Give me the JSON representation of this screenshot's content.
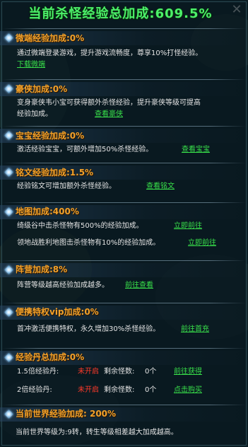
{
  "header": {
    "title": "当前杀怪经验总加成:609.5%",
    "close_label": "✕"
  },
  "sections": [
    {
      "title": "微端经验加成:0%",
      "lines": [
        "通过微端登录游戏，提升游戏流畅度，尊享10%打怪经验。"
      ],
      "link": "下载微端"
    },
    {
      "title": "豪侠加成:0%",
      "lines": [
        "变身豪侠韦小宝可获得额外杀怪经验，提升豪侠等级可提高",
        "经验加成。"
      ],
      "link": "查看豪侠"
    },
    {
      "title": "宝宝经验加成:0%",
      "lines": [
        "激活经验宝宝，可额外增加50%杀怪经验。"
      ],
      "link": "查看宝宝"
    },
    {
      "title": "铭文经验加成:1.5%",
      "lines": [
        "经验铭文可增加额外杀怪经验。"
      ],
      "link": "查看铭文"
    },
    {
      "title": "地图加成:400%",
      "lines": [
        "绮级谷中击杀怪物有500%的经验加成。",
        "领地战胜利地图击杀怪物有10%的经验加成。"
      ],
      "links": [
        "立即前往",
        "立即前往"
      ]
    },
    {
      "title": "阵营加成:8%",
      "lines": [
        "阵营等级越高经验加成越多。"
      ],
      "link": "前往查看"
    },
    {
      "title": "便携特权vip加成:0%",
      "lines": [
        "首冲激活便携特权，永久增加30%杀怪经验。"
      ],
      "link": "前往首充"
    },
    {
      "title": "经验丹总加成:0%",
      "pills": [
        {
          "label": "1.5倍经验丹:",
          "status": "未开启",
          "remain_label": "剩余怪数:",
          "remain_value": "0个",
          "link": "前往获得"
        },
        {
          "label": "2倍经验丹:",
          "status": "未开启",
          "remain_label": "剩余怪数:",
          "remain_value": "0个",
          "link": "点击购买"
        }
      ]
    },
    {
      "title": "当前世界经验加成: 200%",
      "lines": [
        "当前世界等级为:9转，转生等级相差越大加成越高。"
      ]
    }
  ]
}
